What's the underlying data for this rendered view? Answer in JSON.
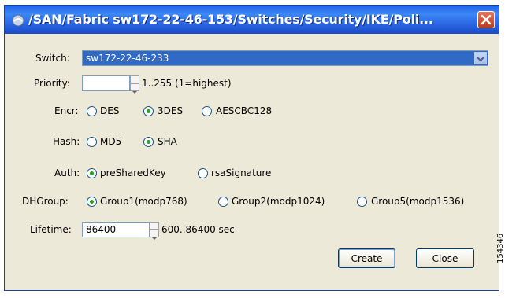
{
  "window": {
    "title": "/SAN/Fabric sw172-22-46-153/Switches/Security/IKE/Poli..."
  },
  "form": {
    "switch_label": "Switch:",
    "switch_value": "sw172-22-46-233",
    "priority_label": "Priority:",
    "priority_value": "",
    "priority_hint": "1..255 (1=highest)",
    "encr_label": "Encr:",
    "encr_options": [
      "DES",
      "3DES",
      "AESCBC128"
    ],
    "encr_selected": "3DES",
    "hash_label": "Hash:",
    "hash_options": [
      "MD5",
      "SHA"
    ],
    "hash_selected": "SHA",
    "auth_label": "Auth:",
    "auth_options": [
      "preSharedKey",
      "rsaSignature"
    ],
    "auth_selected": "preSharedKey",
    "dh_label": "DHGroup:",
    "dh_options": [
      "Group1(modp768)",
      "Group2(modp1024)",
      "Group5(modp1536)"
    ],
    "dh_selected": "Group1(modp768)",
    "lifetime_label": "Lifetime:",
    "lifetime_value": "86400",
    "lifetime_hint": "600..86400 sec"
  },
  "buttons": {
    "create": "Create",
    "close": "Close"
  },
  "figure_id": "154346",
  "colors": {
    "titlebar": "#2862df",
    "selection": "#316ac5",
    "close_button": "#d9502d"
  }
}
